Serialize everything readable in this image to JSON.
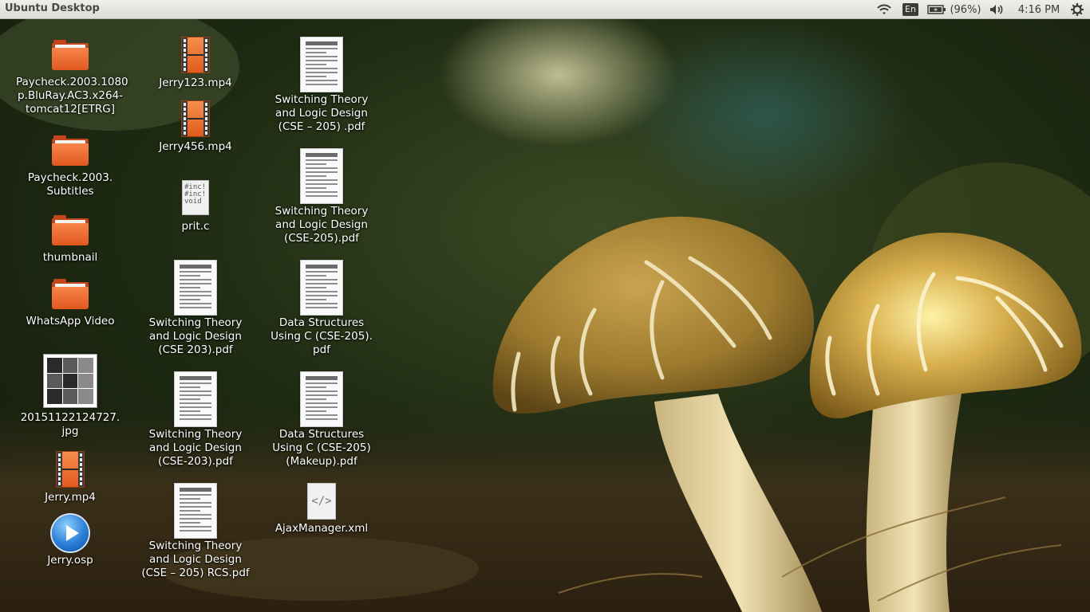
{
  "panel": {
    "title": "Ubuntu Desktop",
    "language": "En",
    "battery": "(96%)",
    "clock": "4:16 PM",
    "icons": [
      "wifi-icon",
      "keyboard-layout-indicator",
      "battery-charging-icon",
      "volume-icon",
      "settings-gear-icon"
    ]
  },
  "desktop": {
    "col1": [
      {
        "label": "Paycheck.2003.1080\np.BluRay.AC3.x264-\ntomcat12[ETRG]",
        "kind": "folder"
      },
      {
        "label": "Paycheck.2003.\nSubtitles",
        "kind": "folder"
      },
      {
        "label": "thumbnail",
        "kind": "folder"
      },
      {
        "label": "WhatsApp Video",
        "kind": "folder"
      },
      {
        "label": "20151122124727.\njpg",
        "kind": "image"
      },
      {
        "label": "Jerry.mp4",
        "kind": "video"
      },
      {
        "label": "Jerry.osp",
        "kind": "osp"
      }
    ],
    "col2": [
      {
        "label": "Jerry123.mp4",
        "kind": "video"
      },
      {
        "label": "Jerry456.mp4",
        "kind": "video"
      },
      {
        "label": "prit.c",
        "kind": "c-source"
      },
      {
        "label": "Switching Theory\nand Logic Design\n(CSE 203).pdf",
        "kind": "pdf"
      },
      {
        "label": "Switching Theory\nand Logic Design\n(CSE-203).pdf",
        "kind": "pdf"
      },
      {
        "label": "Switching Theory\nand Logic Design\n(CSE – 205) RCS.pdf",
        "kind": "pdf"
      }
    ],
    "col3": [
      {
        "label": "Switching Theory\nand Logic Design\n(CSE – 205) .pdf",
        "kind": "pdf"
      },
      {
        "label": "Switching Theory\nand Logic Design\n(CSE-205).pdf",
        "kind": "pdf"
      },
      {
        "label": "Data Structures\nUsing C (CSE-205).\npdf",
        "kind": "pdf"
      },
      {
        "label": "Data Structures\nUsing C (CSE-205)\n(Makeup).pdf",
        "kind": "pdf"
      },
      {
        "label": "AjaxManager.xml",
        "kind": "xml"
      }
    ]
  },
  "wallpaper": "mushrooms"
}
